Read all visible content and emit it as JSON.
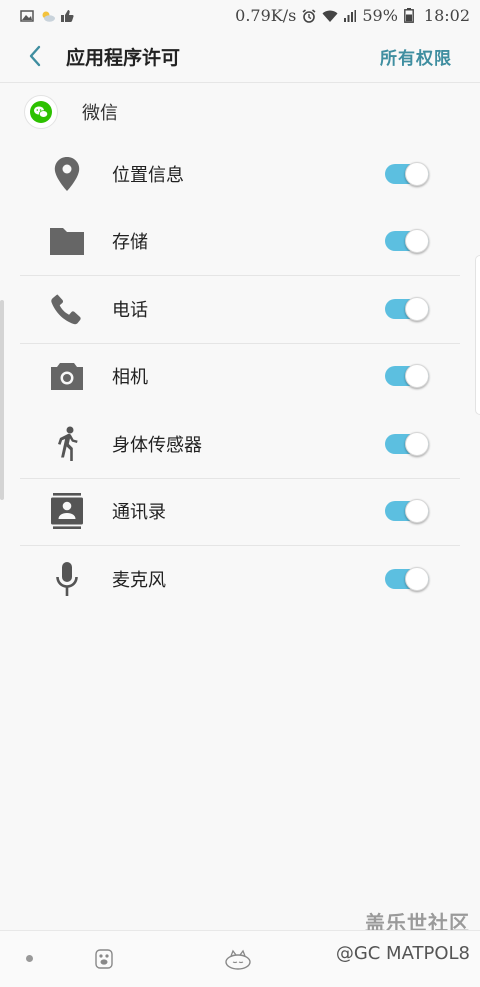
{
  "status_bar": {
    "net_speed": "0.79K/s",
    "battery": "59%",
    "time": "18:02",
    "left_icons": [
      "gallery-icon",
      "weather-icon",
      "thumbs-up-icon"
    ],
    "right_icons": [
      "alarm-icon",
      "wifi-icon",
      "signal-4g-icon",
      "battery-icon"
    ]
  },
  "app_bar": {
    "title": "应用程序许可",
    "action": "所有权限"
  },
  "app": {
    "name": "微信",
    "icon": "wechat-icon"
  },
  "permissions": [
    {
      "label": "位置信息",
      "icon": "location-pin-icon",
      "enabled": true
    },
    {
      "label": "存储",
      "icon": "folder-icon",
      "enabled": true
    },
    {
      "label": "电话",
      "icon": "phone-icon",
      "enabled": true
    },
    {
      "label": "相机",
      "icon": "camera-icon",
      "enabled": true
    },
    {
      "label": "身体传感器",
      "icon": "running-person-icon",
      "enabled": true
    },
    {
      "label": "通讯录",
      "icon": "contacts-icon",
      "enabled": true
    },
    {
      "label": "麦克风",
      "icon": "microphone-icon",
      "enabled": true
    }
  ],
  "watermark": {
    "brand": "盖乐世社区",
    "user": "@GC MATPOL8"
  },
  "colors": {
    "accent": "#3f8ea0",
    "toggle_on": "#5cbfe0",
    "icon_gray": "#666666",
    "wechat_green": "#2dc100"
  }
}
